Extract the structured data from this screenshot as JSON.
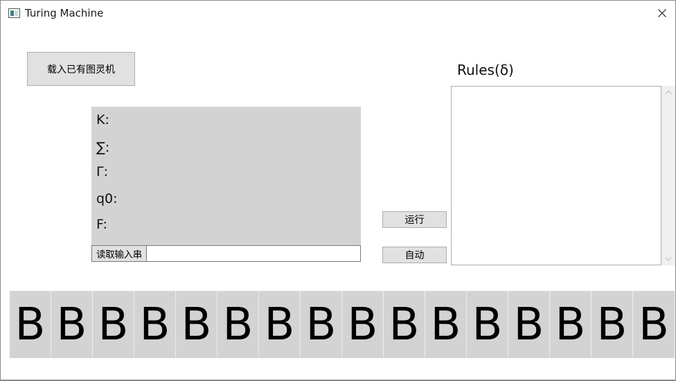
{
  "window": {
    "title": "Turing Machine",
    "icons": {
      "app": "window-app-icon",
      "close": "close-icon"
    }
  },
  "controls": {
    "load_label": "载入已有图灵机",
    "run_label": "运行",
    "auto_label": "自动",
    "read_label": "读取输入串",
    "input_value": ""
  },
  "machine_info": {
    "k_label": "K:",
    "sigma_label": "∑:",
    "gamma_label": "Γ:",
    "q0_label": "q0:",
    "f_label": "F:"
  },
  "rules": {
    "title": "Rules(δ)",
    "content": ""
  },
  "tape": {
    "cells": [
      "B",
      "B",
      "B",
      "B",
      "B",
      "B",
      "B",
      "B",
      "B",
      "B",
      "B",
      "B",
      "B",
      "B",
      "B",
      "B"
    ]
  },
  "colors": {
    "panel_bg": "#d3d3d3",
    "button_bg": "#e1e1e1",
    "icon_accent": "#3c7f8c"
  }
}
